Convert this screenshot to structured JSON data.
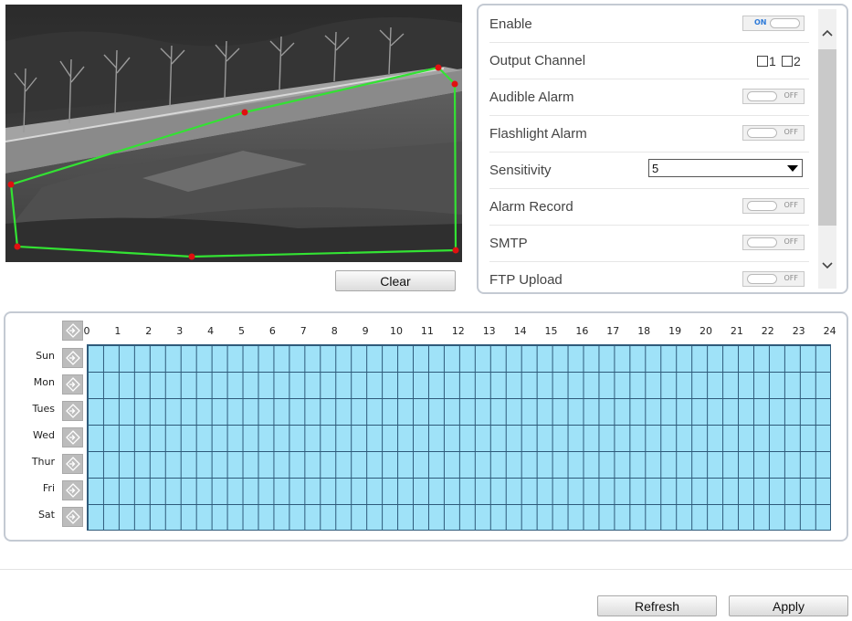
{
  "settings": {
    "enable": {
      "label": "Enable",
      "state": "ON"
    },
    "output_channel": {
      "label": "Output Channel",
      "options": [
        "1",
        "2"
      ]
    },
    "audible_alarm": {
      "label": "Audible Alarm",
      "state": "OFF"
    },
    "flashlight_alarm": {
      "label": "Flashlight Alarm",
      "state": "OFF"
    },
    "sensitivity": {
      "label": "Sensitivity",
      "value": "5"
    },
    "alarm_record": {
      "label": "Alarm Record",
      "state": "OFF"
    },
    "smtp": {
      "label": "SMTP",
      "state": "OFF"
    },
    "ftp_upload": {
      "label": "FTP Upload",
      "state": "OFF"
    }
  },
  "video": {
    "clear_label": "Clear",
    "region_color": "#33e233",
    "vertex_color": "#e01010"
  },
  "schedule": {
    "hours": [
      "0",
      "1",
      "2",
      "3",
      "4",
      "5",
      "6",
      "7",
      "8",
      "9",
      "10",
      "11",
      "12",
      "13",
      "14",
      "15",
      "16",
      "17",
      "18",
      "19",
      "20",
      "21",
      "22",
      "23",
      "24"
    ],
    "days": [
      "Sun",
      "Mon",
      "Tues",
      "Wed",
      "Thur",
      "Fri",
      "Sat"
    ],
    "cell_color": "#9fe2f8"
  },
  "footer": {
    "refresh_label": "Refresh",
    "apply_label": "Apply"
  }
}
